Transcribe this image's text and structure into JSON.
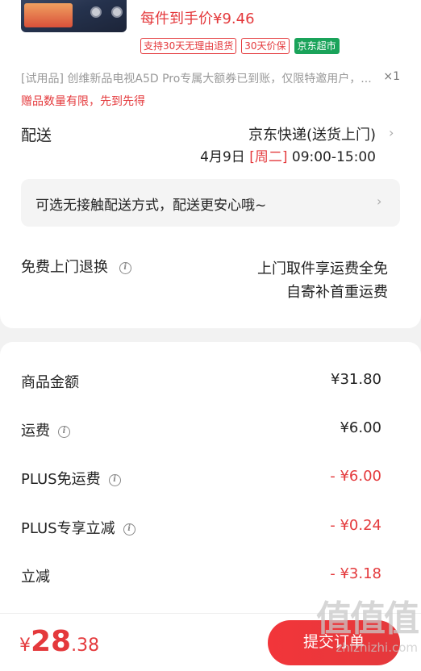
{
  "product": {
    "thumb_label": "",
    "price_text": "每件到手价¥9.46",
    "tags": [
      "支持30天无理由退货",
      "30天价保",
      "京东超市"
    ]
  },
  "gift": {
    "text": "[试用品]  创维新品电视A5D Pro专属大额券已到账，仅限特邀用户，...",
    "qty": "×1",
    "note": "赠品数量有限，先到先得"
  },
  "delivery": {
    "label": "配送",
    "method": "京东快递(送货上门)",
    "time_prefix": "4月9日 ",
    "time_day": "[周二]",
    "time_suffix": " 09:00-15:00",
    "contactless": "可选无接触配送方式，配送更安心哦~"
  },
  "returns": {
    "label": "免费上门退换",
    "line1": "上门取件享运费全免",
    "line2": "自寄补首重运费"
  },
  "summary": {
    "rows": [
      {
        "label": "商品金额",
        "value": "¥31.80"
      },
      {
        "label": "运费",
        "value": "¥6.00"
      },
      {
        "label": "PLUS免运费",
        "value": "- ¥6.00"
      },
      {
        "label": "PLUS专享立减",
        "value": "- ¥0.24"
      },
      {
        "label": "立减",
        "value": "- ¥3.18"
      }
    ]
  },
  "footer": {
    "currency": "¥",
    "total_int": "28",
    "total_dec": ".38",
    "submit_label": "提交订单"
  },
  "watermark": {
    "logo": "值值值",
    "site": "zhizhizhi.com"
  },
  "colors": {
    "accent": "#e4393c",
    "green": "#1aa35a"
  }
}
